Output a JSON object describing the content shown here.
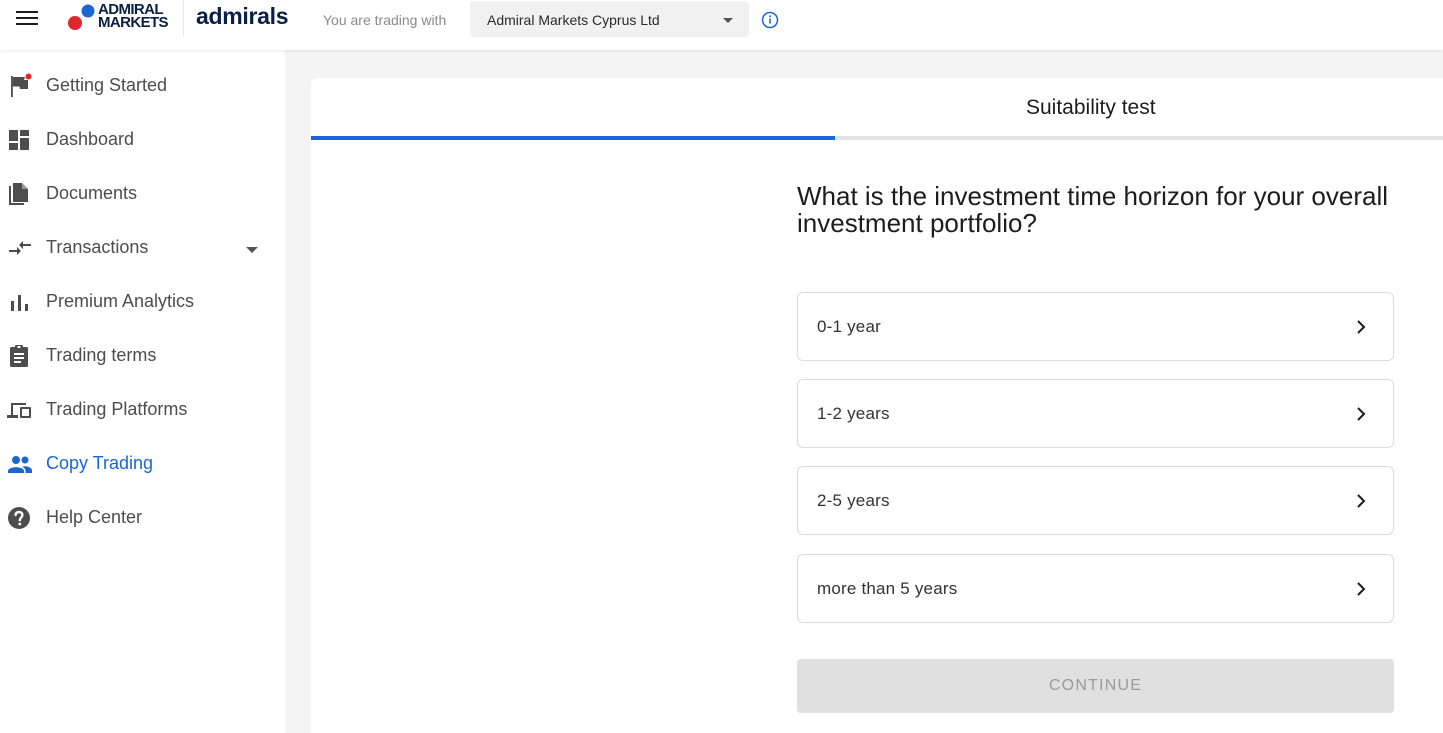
{
  "header": {
    "logo_am": "ADMIRAL\nMARKETS",
    "logo_admirals": "admirals",
    "trading_with_label": "You are trading with",
    "entity_selected": "Admiral Markets Cyprus Ltd"
  },
  "sidebar": {
    "items": [
      {
        "label": "Getting Started",
        "icon": "flag-icon"
      },
      {
        "label": "Dashboard",
        "icon": "dashboard-icon"
      },
      {
        "label": "Documents",
        "icon": "documents-icon"
      },
      {
        "label": "Transactions",
        "icon": "transactions-icon"
      },
      {
        "label": "Premium Analytics",
        "icon": "bar-chart-icon"
      },
      {
        "label": "Trading terms",
        "icon": "clipboard-icon"
      },
      {
        "label": "Trading Platforms",
        "icon": "devices-icon"
      },
      {
        "label": "Copy Trading",
        "icon": "people-icon"
      },
      {
        "label": "Help Center",
        "icon": "help-icon"
      }
    ],
    "active_item": "Copy Trading"
  },
  "test": {
    "title": "Suitability test",
    "progress": 0.46,
    "question": "What is the investment time horizon for your overall investment portfolio?",
    "options": [
      "0-1 year",
      "1-2 years",
      "2-5 years",
      "more than 5 years"
    ],
    "continue_label": "CONTINUE"
  },
  "colors": {
    "accent": "#1b66d2",
    "logo_navy": "#0a1f44",
    "logo_red": "#e0262c",
    "disabled_bg": "#e0e0e0"
  }
}
